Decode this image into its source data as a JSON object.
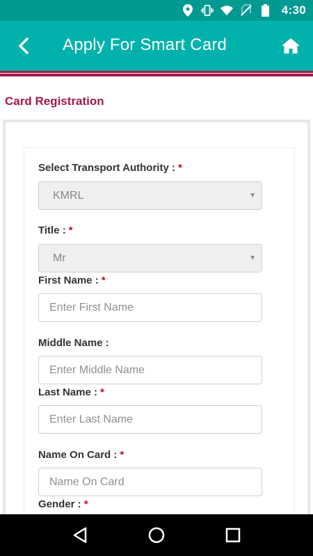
{
  "status_bar": {
    "time": "4:30",
    "icons": [
      "location-icon",
      "vibrate-icon",
      "wifi-icon",
      "no-sim-icon",
      "battery-icon"
    ]
  },
  "app_bar": {
    "title": "Apply For Smart Card",
    "back_icon": "chevron-left-icon",
    "home_icon": "home-icon",
    "background_color": "#00b2ab",
    "status_color": "#009a93",
    "accent_color": "#a4174a"
  },
  "section": {
    "title": "Card Registration"
  },
  "form": {
    "transport_authority": {
      "label": "Select Transport Authority :",
      "required_mark": "*",
      "value": "KMRL"
    },
    "title": {
      "label": "Title :",
      "required_mark": "*",
      "value": "Mr"
    },
    "first_name": {
      "label": "First Name :",
      "required_mark": "*",
      "placeholder": "Enter First Name"
    },
    "middle_name": {
      "label": "Middle Name :",
      "placeholder": "Enter Middle Name"
    },
    "last_name": {
      "label": "Last Name :",
      "required_mark": "*",
      "placeholder": "Enter Last Name"
    },
    "name_on_card": {
      "label": "Name On Card :",
      "required_mark": "*",
      "placeholder": "Name On Card"
    },
    "gender": {
      "label": "Gender :",
      "required_mark": "*"
    }
  },
  "nav_bar": {
    "icons": [
      "back-triangle-icon",
      "home-circle-icon",
      "recents-square-icon"
    ]
  }
}
